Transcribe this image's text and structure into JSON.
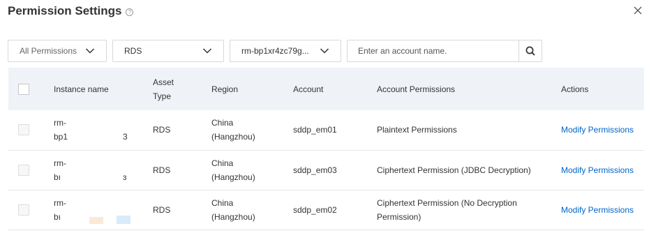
{
  "dialog": {
    "title": "Permission Settings",
    "help_icon": "help-circle-icon",
    "close_icon": "close-icon"
  },
  "filters": {
    "permissions": "All Permissions",
    "db_type": "RDS",
    "instance": "rm-bp1xr4zc79g...",
    "search_placeholder": "Enter an account name.",
    "search_value": "",
    "search_icon": "search-icon"
  },
  "table": {
    "columns": [
      "Instance name",
      "Asset Type",
      "Region",
      "Account",
      "Account Permissions",
      "Actions"
    ],
    "rows": [
      {
        "inst1": "rm-",
        "inst2": "bp1",
        "inst_tail": "3",
        "asset": "RDS",
        "region1": "China",
        "region2": "(Hangzhou)",
        "account": "sddp_em01",
        "perm1": "Plaintext Permissions",
        "perm2": "",
        "action": "Modify Permissions"
      },
      {
        "inst1": "rm-",
        "inst2": "bı",
        "inst_tail": "ɜ",
        "asset": "RDS",
        "region1": "China",
        "region2": "(Hangzhou)",
        "account": "sddp_em03",
        "perm1": "Ciphertext Permission (JDBC Decryption)",
        "perm2": "",
        "action": "Modify Permissions"
      },
      {
        "inst1": "rm-",
        "inst2": "bı",
        "inst_tail": "",
        "asset": "RDS",
        "region1": "China",
        "region2": "(Hangzhou)",
        "account": "sddp_em02",
        "perm1": "Ciphertext Permission (No Decryption",
        "perm2": "Permission)",
        "action": "Modify Permissions"
      }
    ]
  }
}
